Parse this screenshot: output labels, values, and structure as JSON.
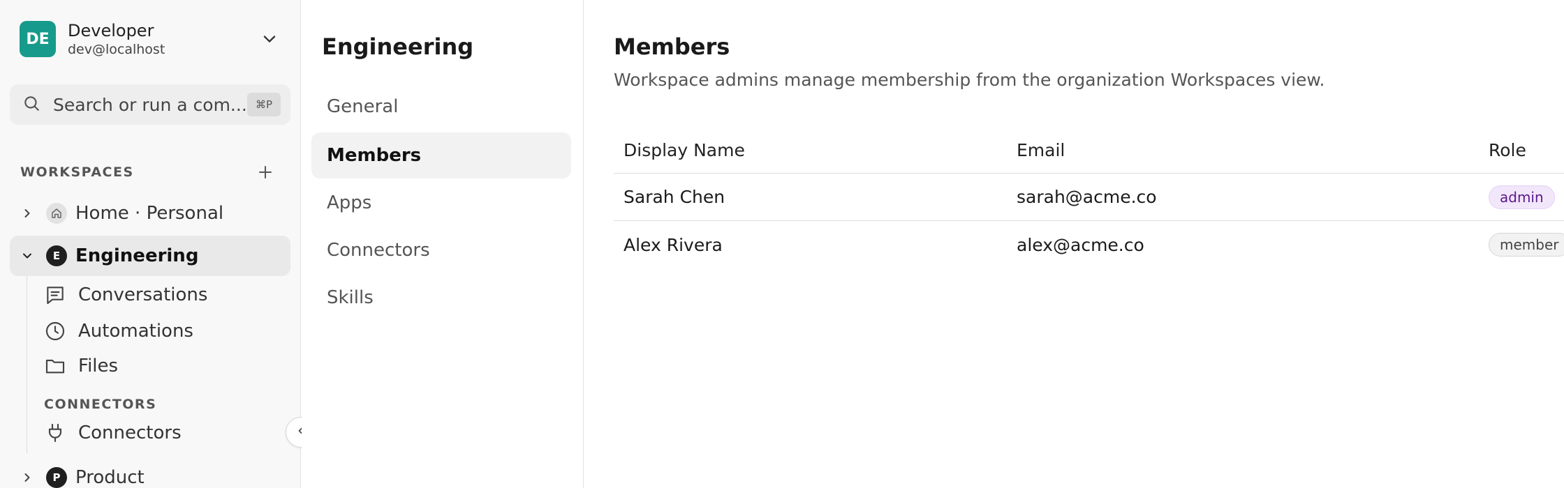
{
  "account": {
    "initials": "DE",
    "name": "Developer",
    "email": "dev@localhost",
    "avatar_color": "#169a8b"
  },
  "search": {
    "placeholder": "Search or run a com...",
    "shortcut": "⌘P"
  },
  "sidebar": {
    "workspaces_label": "WORKSPACES",
    "workspaces": [
      {
        "label": "Home · Personal",
        "badge": "",
        "icon": "home-icon",
        "expanded": false
      },
      {
        "label": "Engineering",
        "badge": "E",
        "expanded": true,
        "active": true
      },
      {
        "label": "Product",
        "badge": "P",
        "expanded": false
      }
    ],
    "engineering_items": [
      {
        "label": "Conversations",
        "icon": "conversations-icon"
      },
      {
        "label": "Automations",
        "icon": "clock-icon"
      },
      {
        "label": "Files",
        "icon": "folder-icon"
      }
    ],
    "connectors_label": "CONNECTORS",
    "connector_items": [
      {
        "label": "Connectors",
        "icon": "plug-icon"
      }
    ]
  },
  "settings_nav": {
    "title": "Engineering",
    "items": [
      {
        "label": "General",
        "active": false
      },
      {
        "label": "Members",
        "active": true
      },
      {
        "label": "Apps",
        "active": false
      },
      {
        "label": "Connectors",
        "active": false
      },
      {
        "label": "Skills",
        "active": false
      }
    ]
  },
  "main": {
    "title": "Members",
    "description": "Workspace admins manage membership from the organization Workspaces view.",
    "table": {
      "headers": [
        "Display Name",
        "Email",
        "Role"
      ],
      "rows": [
        {
          "name": "Sarah Chen",
          "email": "sarah@acme.co",
          "role": "admin"
        },
        {
          "name": "Alex Rivera",
          "email": "alex@acme.co",
          "role": "member"
        }
      ]
    }
  }
}
